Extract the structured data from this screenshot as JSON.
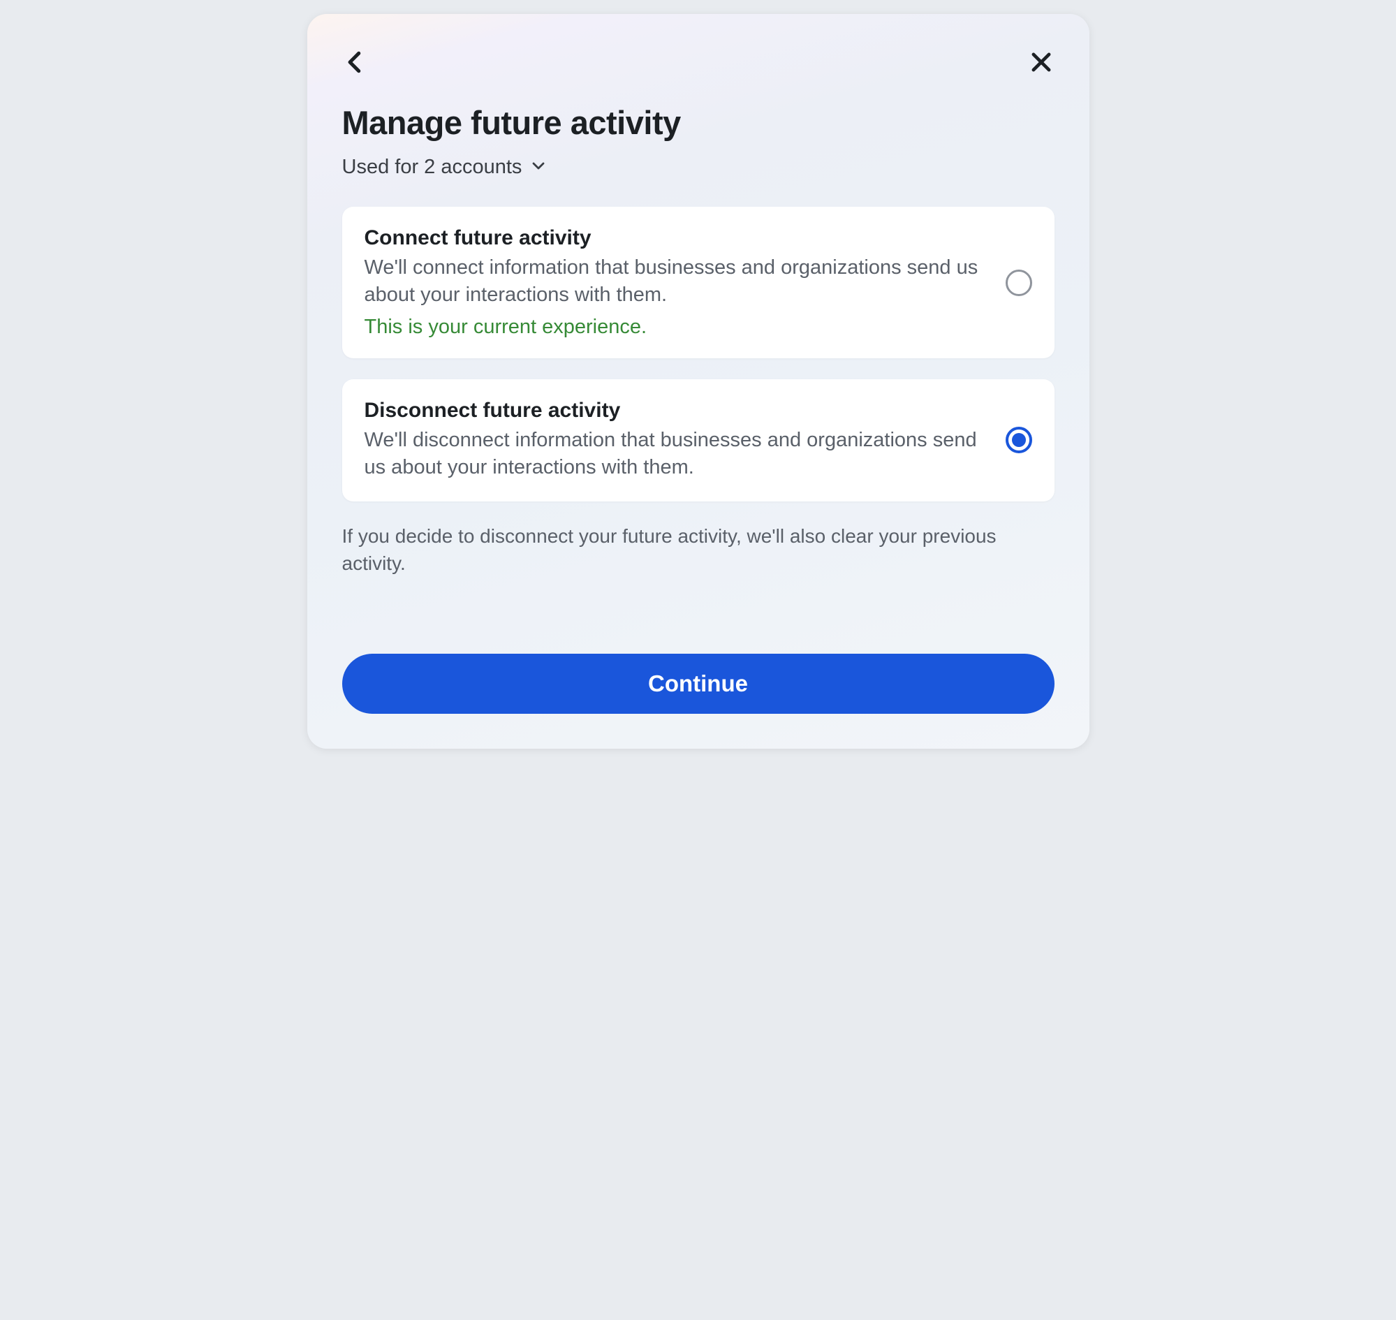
{
  "header": {
    "title": "Manage future activity",
    "subtitle": "Used for 2 accounts"
  },
  "options": [
    {
      "title": "Connect future activity",
      "description": "We'll connect information that businesses and organizations send us about your interactions with them.",
      "note": "This is your current experience.",
      "selected": false
    },
    {
      "title": "Disconnect future activity",
      "description": "We'll disconnect information that businesses and organizations send us about your interactions with them.",
      "note": "",
      "selected": true
    }
  ],
  "footer_note": "If you decide to disconnect your future activity, we'll also clear your previous activity.",
  "actions": {
    "continue_label": "Continue"
  }
}
